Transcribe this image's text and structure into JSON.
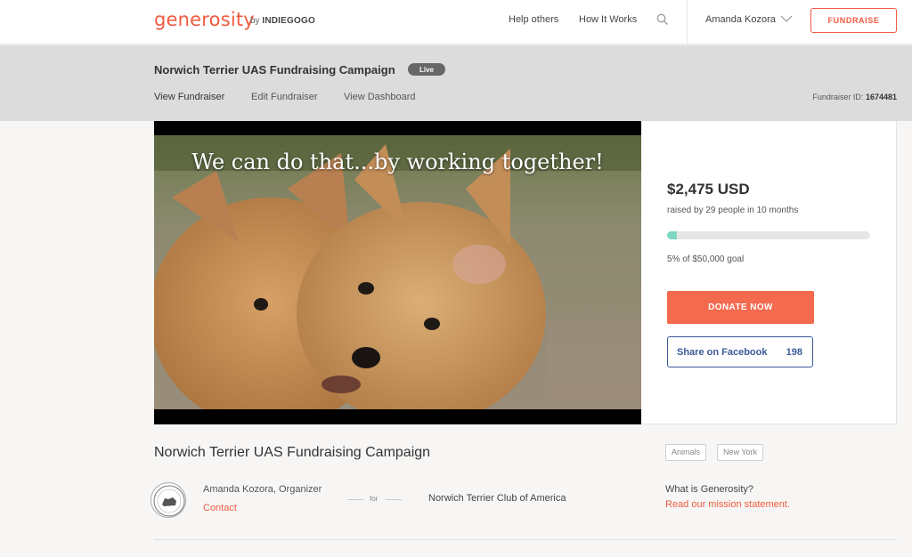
{
  "brand": {
    "logo": "generosity",
    "by": "by",
    "partner": "INDIEGOGO",
    "accent": "#f05a3f"
  },
  "nav": {
    "help_others": "Help others",
    "how_it_works": "How It Works",
    "search_icon": "search-icon",
    "user": "Amanda Kozora",
    "fundraise": "FUNDRAISE"
  },
  "header": {
    "campaign_title": "Norwich Terrier UAS Fundraising Campaign",
    "status": "Live",
    "tabs": [
      "View Fundraiser",
      "Edit Fundraiser",
      "View Dashboard"
    ],
    "fundraiser_id_label": "Fundraiser ID:",
    "fundraiser_id": "1674481"
  },
  "hero": {
    "caption": "We can do that...by working together!"
  },
  "stats": {
    "amount": "$2,475 USD",
    "raised_by": "raised by 29 people in 10 months",
    "progress_percent": 5,
    "goal_text": "5% of $50,000 goal",
    "donate": "DONATE NOW",
    "share_label": "Share on Facebook",
    "share_count": "198"
  },
  "details": {
    "title": "Norwich Terrier UAS Fundraising Campaign",
    "tags": [
      "Animals",
      "New York"
    ],
    "organizer": "Amanda Kozora, Organizer",
    "contact": "Contact",
    "for": "for",
    "beneficiary": "Norwich Terrier Club of America",
    "what_is": "What is Generosity?",
    "mission": "Read our mission statement."
  }
}
